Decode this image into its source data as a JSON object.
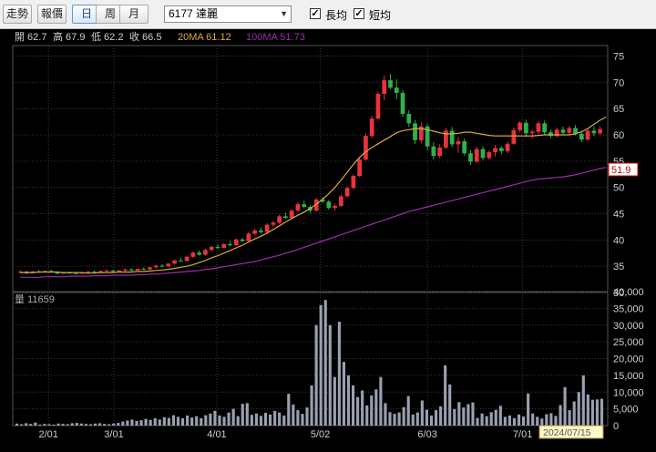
{
  "toolbar": {
    "buttons": [
      "走勢",
      "報價",
      "日",
      "周",
      "月"
    ],
    "active_button": "日",
    "symbol": "6177 達麗",
    "checkbox_long_label": "長均",
    "checkbox_short_label": "短均",
    "checkbox_long_checked": true,
    "checkbox_short_checked": true
  },
  "price_header": {
    "open": "開 62.7",
    "high": "高 67.9",
    "low": "低 62.2",
    "close": "收 66.5",
    "ma20": "20MA 61.12",
    "ma100": "100MA 51.73"
  },
  "volume_header": "量 11659",
  "last_price_tag": "51.9",
  "cursor_date": "2024/07/15",
  "colors": {
    "up": "#e8333a",
    "down": "#2fb24a",
    "ma20": "#d8a93c",
    "ma100": "#9a2fa8",
    "volume": "#9aa0b0",
    "grid": "#3a3a3a",
    "axis_text": "#cfcfcf",
    "header_text": "#d0d0d0"
  },
  "chart_data": [
    {
      "type": "candlestick",
      "title": "",
      "x_tick_labels": [
        "2/01",
        "3/01",
        "4/01",
        "5/02",
        "6/03",
        "7/01"
      ],
      "y_ticks": [
        30,
        35,
        40,
        45,
        50,
        55,
        60,
        65,
        70,
        75
      ],
      "ylim": [
        30,
        77
      ],
      "grid": true,
      "series": [
        {
          "name": "20MA",
          "values": [
            33.8,
            33.8,
            33.8,
            33.9,
            33.9,
            33.9,
            33.9,
            33.8,
            33.8,
            33.8,
            33.8,
            33.7,
            33.7,
            33.8,
            33.8,
            33.8,
            33.9,
            33.9,
            33.9,
            34.0,
            34.0,
            34.1,
            34.2,
            34.3,
            34.4,
            34.6,
            34.8,
            35.0,
            35.3,
            35.7,
            36.1,
            36.6,
            37.0,
            37.5,
            38.0,
            38.5,
            39.0,
            39.6,
            40.2,
            40.7,
            41.3,
            42.0,
            42.7,
            43.4,
            44.1,
            44.7,
            45.3,
            46.0,
            46.8,
            47.7,
            48.8,
            50.0,
            51.4,
            52.9,
            54.4,
            55.7,
            56.8,
            57.6,
            58.3,
            59.0,
            59.7,
            60.4,
            60.8,
            61.0,
            61.2,
            61.2,
            61.0,
            60.7,
            60.4,
            60.2,
            60.2,
            60.3,
            60.5,
            60.5,
            60.3,
            60.1,
            59.9,
            59.8,
            59.8,
            59.8,
            59.8,
            59.8,
            59.8,
            59.8,
            59.9,
            60.0,
            60.0,
            60.0,
            60.0,
            60.0,
            60.2,
            60.6,
            61.2,
            62.0,
            62.8,
            63.4
          ]
        },
        {
          "name": "100MA",
          "values": [
            32.9,
            32.9,
            32.9,
            32.9,
            33.0,
            33.0,
            33.0,
            33.0,
            33.1,
            33.1,
            33.1,
            33.1,
            33.2,
            33.2,
            33.2,
            33.3,
            33.3,
            33.3,
            33.3,
            33.4,
            33.4,
            33.5,
            33.5,
            33.6,
            33.7,
            33.8,
            33.9,
            34.0,
            34.1,
            34.2,
            34.4,
            34.5,
            34.7,
            34.9,
            35.1,
            35.3,
            35.5,
            35.7,
            35.9,
            36.2,
            36.5,
            36.8,
            37.1,
            37.5,
            37.8,
            38.2,
            38.6,
            39.0,
            39.4,
            39.8,
            40.2,
            40.6,
            41.0,
            41.4,
            41.8,
            42.2,
            42.6,
            43.0,
            43.4,
            43.8,
            44.2,
            44.6,
            45.0,
            45.4,
            45.7,
            46.0,
            46.3,
            46.6,
            46.9,
            47.2,
            47.5,
            47.8,
            48.1,
            48.4,
            48.7,
            49.0,
            49.3,
            49.6,
            49.9,
            50.2,
            50.5,
            50.8,
            51.1,
            51.4,
            51.6,
            51.7,
            51.8,
            51.9,
            52.0,
            52.2,
            52.4,
            52.7,
            53.0,
            53.3,
            53.6,
            53.8
          ]
        }
      ],
      "candles": [
        [
          33.8,
          34.2,
          33.6,
          34.0
        ],
        [
          34.0,
          34.1,
          33.5,
          33.7
        ],
        [
          33.7,
          34.1,
          33.6,
          34.0
        ],
        [
          34.0,
          34.3,
          33.7,
          33.9
        ],
        [
          33.9,
          34.2,
          33.8,
          34.1
        ],
        [
          34.1,
          34.3,
          33.8,
          33.9
        ],
        [
          33.9,
          34.0,
          33.5,
          33.6
        ],
        [
          33.6,
          33.9,
          33.5,
          33.8
        ],
        [
          33.8,
          34.0,
          33.6,
          33.7
        ],
        [
          33.7,
          33.9,
          33.4,
          33.6
        ],
        [
          33.6,
          33.9,
          33.5,
          33.8
        ],
        [
          33.8,
          34.1,
          33.7,
          34.0
        ],
        [
          34.0,
          34.2,
          33.8,
          33.9
        ],
        [
          33.9,
          34.2,
          33.8,
          34.1
        ],
        [
          34.1,
          34.4,
          34.0,
          34.2
        ],
        [
          34.2,
          34.3,
          33.9,
          34.0
        ],
        [
          34.0,
          34.3,
          33.9,
          34.2
        ],
        [
          34.2,
          34.5,
          34.0,
          34.4
        ],
        [
          34.4,
          34.6,
          34.1,
          34.2
        ],
        [
          34.2,
          34.6,
          34.1,
          34.5
        ],
        [
          34.5,
          34.8,
          34.3,
          34.4
        ],
        [
          34.4,
          34.9,
          34.3,
          34.8
        ],
        [
          34.8,
          35.3,
          34.6,
          35.1
        ],
        [
          35.1,
          35.4,
          34.8,
          35.0
        ],
        [
          35.0,
          35.6,
          34.9,
          35.5
        ],
        [
          35.5,
          36.3,
          35.3,
          36.1
        ],
        [
          36.1,
          36.6,
          35.8,
          36.0
        ],
        [
          36.0,
          37.0,
          35.9,
          36.8
        ],
        [
          36.8,
          37.8,
          36.6,
          37.6
        ],
        [
          37.6,
          38.0,
          37.0,
          37.2
        ],
        [
          37.2,
          38.3,
          37.0,
          38.1
        ],
        [
          38.1,
          38.9,
          37.8,
          38.7
        ],
        [
          38.7,
          39.2,
          38.3,
          38.5
        ],
        [
          38.5,
          39.4,
          38.4,
          39.2
        ],
        [
          39.2,
          39.8,
          38.8,
          39.0
        ],
        [
          39.0,
          40.3,
          38.9,
          40.1
        ],
        [
          40.1,
          40.4,
          39.6,
          39.8
        ],
        [
          39.8,
          41.5,
          39.7,
          41.2
        ],
        [
          41.2,
          42.2,
          40.9,
          41.8
        ],
        [
          41.8,
          42.4,
          41.2,
          41.5
        ],
        [
          41.5,
          43.2,
          41.3,
          42.9
        ],
        [
          42.9,
          43.6,
          42.5,
          43.3
        ],
        [
          43.3,
          44.8,
          43.0,
          44.5
        ],
        [
          44.5,
          45.2,
          44.0,
          44.2
        ],
        [
          44.2,
          45.9,
          44.0,
          45.6
        ],
        [
          45.6,
          47.2,
          45.3,
          46.8
        ],
        [
          46.8,
          47.5,
          46.0,
          46.3
        ],
        [
          46.3,
          46.6,
          45.2,
          45.6
        ],
        [
          45.6,
          48.0,
          45.4,
          47.7
        ],
        [
          47.7,
          48.2,
          47.0,
          47.3
        ],
        [
          47.3,
          47.6,
          45.8,
          46.1
        ],
        [
          46.1,
          46.9,
          45.6,
          46.5
        ],
        [
          46.5,
          48.7,
          46.3,
          48.3
        ],
        [
          48.3,
          50.2,
          48.1,
          49.9
        ],
        [
          49.9,
          52.5,
          49.7,
          52.2
        ],
        [
          52.2,
          55.8,
          52.0,
          55.3
        ],
        [
          55.3,
          60.3,
          55.1,
          59.8
        ],
        [
          59.8,
          63.6,
          59.4,
          63.1
        ],
        [
          63.1,
          68.2,
          62.9,
          67.8
        ],
        [
          67.8,
          71.3,
          66.6,
          70.4
        ],
        [
          70.4,
          71.6,
          68.7,
          69.0
        ],
        [
          69.0,
          70.6,
          66.8,
          68.0
        ],
        [
          68.0,
          68.5,
          63.4,
          64.0
        ],
        [
          64.0,
          64.7,
          61.5,
          62.2
        ],
        [
          62.2,
          62.8,
          58.3,
          59.0
        ],
        [
          59.0,
          62.4,
          58.4,
          61.6
        ],
        [
          61.6,
          62.1,
          57.0,
          57.8
        ],
        [
          57.8,
          58.6,
          55.3,
          56.0
        ],
        [
          56.0,
          58.2,
          55.6,
          57.6
        ],
        [
          57.6,
          61.3,
          57.3,
          60.8
        ],
        [
          60.8,
          61.5,
          57.7,
          58.2
        ],
        [
          58.2,
          59.6,
          56.6,
          58.8
        ],
        [
          58.8,
          59.3,
          56.1,
          56.5
        ],
        [
          56.5,
          57.1,
          54.3,
          54.9
        ],
        [
          54.9,
          57.7,
          54.6,
          57.3
        ],
        [
          57.3,
          57.8,
          55.2,
          55.6
        ],
        [
          55.6,
          57.0,
          55.3,
          56.7
        ],
        [
          56.7,
          58.1,
          55.9,
          57.5
        ],
        [
          57.5,
          57.9,
          56.3,
          56.9
        ],
        [
          56.9,
          58.7,
          56.5,
          58.3
        ],
        [
          58.3,
          61.4,
          58.1,
          60.9
        ],
        [
          60.9,
          62.6,
          60.5,
          62.3
        ],
        [
          62.3,
          62.9,
          59.6,
          60.3
        ],
        [
          60.3,
          61.0,
          59.3,
          60.6
        ],
        [
          60.6,
          62.6,
          60.1,
          62.2
        ],
        [
          62.2,
          62.7,
          59.9,
          60.5
        ],
        [
          60.5,
          61.0,
          59.4,
          59.8
        ],
        [
          59.8,
          61.4,
          59.5,
          61.0
        ],
        [
          61.0,
          61.6,
          60.0,
          60.4
        ],
        [
          60.4,
          61.7,
          60.1,
          61.3
        ],
        [
          61.3,
          61.9,
          59.9,
          60.2
        ],
        [
          60.2,
          60.8,
          58.6,
          59.1
        ],
        [
          59.1,
          61.2,
          58.9,
          60.8
        ],
        [
          60.8,
          61.5,
          59.8,
          60.3
        ],
        [
          60.3,
          61.6,
          60.0,
          61.1
        ]
      ]
    },
    {
      "type": "bar",
      "title": "",
      "y_tick_labels": [
        "0",
        "5,000",
        "10,000",
        "15,000",
        "20,000",
        "25,000",
        "30,000",
        "35,000",
        "40,000"
      ],
      "y_ticks": [
        0,
        5000,
        10000,
        15000,
        20000,
        25000,
        30000,
        35000,
        40000
      ],
      "ylim": [
        0,
        40000
      ],
      "values": [
        600,
        400,
        700,
        500,
        900,
        300,
        500,
        400,
        300,
        600,
        500,
        400,
        700,
        800,
        600,
        500,
        400,
        600,
        700,
        500,
        400,
        600,
        800,
        1200,
        1500,
        1800,
        1400,
        1600,
        2000,
        1700,
        2200,
        1800,
        2500,
        2300,
        3100,
        2600,
        2200,
        3000,
        2400,
        2800,
        2200,
        3100,
        3600,
        4400,
        3000,
        2600,
        3900,
        5000,
        2800,
        6500,
        6700,
        3200,
        3600,
        2900,
        3800,
        3300,
        4400,
        3900,
        3000,
        9500,
        6300,
        4600,
        3500,
        5400,
        12000,
        30000,
        36000,
        37500,
        30000,
        14500,
        31000,
        19000,
        15000,
        12000,
        8500,
        10500,
        6000,
        9000,
        10800,
        14500,
        6700,
        4000,
        3500,
        3900,
        5500,
        8800,
        3300,
        3900,
        7500,
        4700,
        3000,
        4600,
        5700,
        18000,
        12300,
        4900,
        7000,
        5400,
        6400,
        6900,
        2300,
        3600,
        2800,
        4000,
        4700,
        5900,
        2600,
        3000,
        2200,
        3300,
        2700,
        9600,
        3600,
        2600,
        2100,
        3400,
        3700,
        2900,
        6100,
        11500,
        4600,
        7200,
        10000,
        15000,
        9300,
        7700,
        7800,
        8000
      ],
      "cursor_label": "2024/07/15"
    }
  ]
}
